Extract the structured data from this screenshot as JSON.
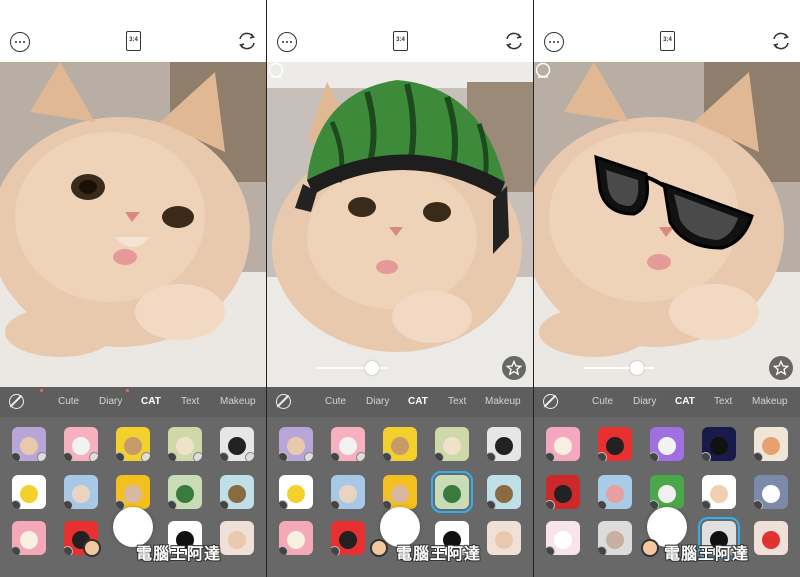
{
  "topbar": {
    "ratio_label": "3:4"
  },
  "tray": {
    "tabs_variant_a": [
      "Cute",
      "Diary",
      "CAT",
      "Text",
      "Makeup"
    ],
    "tabs_variant_b": [
      "Cute",
      "Diary",
      "CAT",
      "Text",
      "Makeup"
    ],
    "tabs_variant_c": [
      "Cute",
      "Diary",
      "CAT",
      "Text",
      "Makeup"
    ],
    "active_tab": "CAT"
  },
  "panels": [
    {
      "effect": "none",
      "show_slider": false,
      "slider_value": 0.0
    },
    {
      "effect": "watermelon-helmet",
      "show_slider": true,
      "slider_value": 0.78
    },
    {
      "effect": "cat-eye-sunglasses",
      "show_slider": true,
      "slider_value": 0.75
    }
  ],
  "watermark": {
    "text": "電腦王阿達"
  },
  "colors": {
    "tray": "#686868",
    "tabbar": "#5e5e5e",
    "selected_outline": "#2fb0f0",
    "cat_fur": "#e8c9ad"
  },
  "icons": [
    "more-icon",
    "aspect-ratio-icon",
    "flip-camera-icon",
    "no-effect-icon",
    "compare-icon",
    "favorite-star-icon"
  ]
}
